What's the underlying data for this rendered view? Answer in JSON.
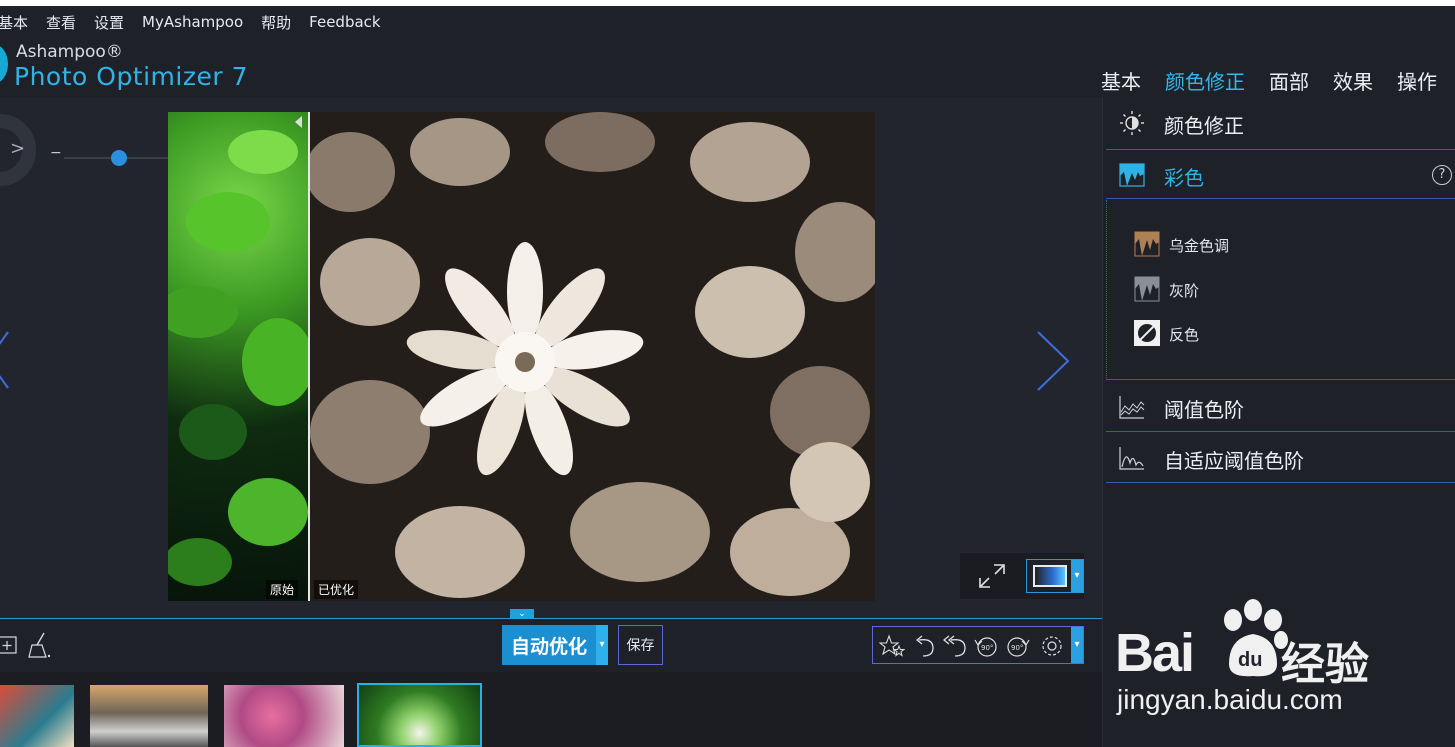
{
  "menu": {
    "items": [
      "基本",
      "查看",
      "设置",
      "MyAshampoo",
      "帮助",
      "Feedback"
    ]
  },
  "brand": {
    "small": "Ashampoo®",
    "big": "Photo Optimizer 7"
  },
  "main_tabs": [
    {
      "label": "基本"
    },
    {
      "label": "颜色修正",
      "active": true
    },
    {
      "label": "面部"
    },
    {
      "label": "效果"
    },
    {
      "label": "操作"
    }
  ],
  "viewer": {
    "zoom_minus": "−",
    "zoom_plus": "+",
    "zoom_level": 0.42,
    "label_original": "原始",
    "label_optimized": "已优化"
  },
  "toolbar": {
    "auto_optimize": "自动优化",
    "save": "保存",
    "tools": [
      "star-icon",
      "undo-icon",
      "undo-all-icon",
      "rotate-left-90-icon",
      "rotate-right-90-icon",
      "gear-icon"
    ],
    "rotate_label": "90°"
  },
  "panel": {
    "section_title": "颜色修正",
    "color_title": "彩色",
    "help": "?",
    "color_items": [
      "乌金色调",
      "灰阶",
      "反色"
    ],
    "threshold": "阈值色阶",
    "adaptive_threshold": "自适应阈值色阶"
  },
  "watermark": {
    "logo_text": "Bai",
    "logo_du": "du",
    "brand_cn": "经验",
    "url": "jingyan.baidu.com"
  },
  "colors": {
    "accent": "#2fb2e6",
    "background": "#22252d",
    "border_blue": "#3a57b8"
  }
}
